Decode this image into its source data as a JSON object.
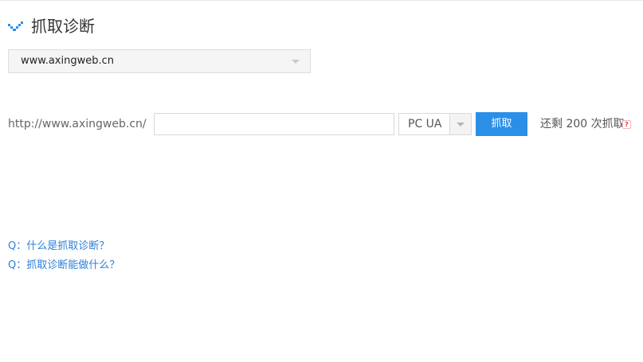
{
  "header": {
    "title": "抓取诊断",
    "icon": "checkmark-icon",
    "accent": "#2b8fe8"
  },
  "site_select": {
    "value": "www.axingweb.cn"
  },
  "fetch_form": {
    "url_prefix": "http://www.axingweb.cn/",
    "path_value": "",
    "ua_value": "PC UA",
    "button_label": "抓取",
    "remaining_text": "还剩 200 次抓取",
    "help_badge": "?"
  },
  "faq": {
    "items": [
      "Q：什么是抓取诊断？",
      "Q：抓取诊断能做什么？"
    ]
  },
  "colors": {
    "button_bg": "#2b8fe8",
    "link": "#2b7fd6"
  }
}
